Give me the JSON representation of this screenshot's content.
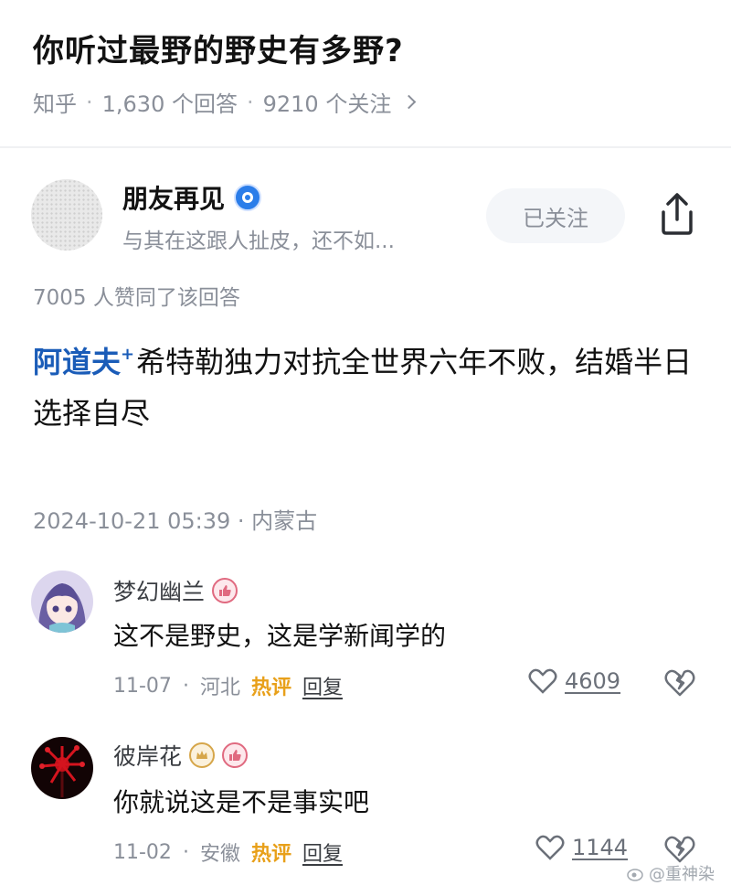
{
  "question": {
    "title": "你听过最野的野史有多野?",
    "source": "知乎",
    "answers": "1,630 个回答",
    "followers": "9210 个关注"
  },
  "author": {
    "name": "朋友再见",
    "bio": "与其在这跟人扯皮，还不如...",
    "follow_label": "已关注"
  },
  "answer": {
    "likes_text": "7005 人赞同了该回答",
    "link_text": "阿道夫",
    "body_text": "希特勒独力对抗全世界六年不败，结婚半日选择自尽",
    "date": "2024-10-21 05:39 · 内蒙古"
  },
  "comments": [
    {
      "name": "梦幻幽兰",
      "text": "这不是野史，这是学新闻学的",
      "date": "11-07",
      "location": "河北",
      "hot_label": "热评",
      "reply_label": "回复",
      "likes": "4609"
    },
    {
      "name": "彼岸花",
      "text": "你就说这是不是事实吧",
      "date": "11-02",
      "location": "安徽",
      "hot_label": "热评",
      "reply_label": "回复",
      "likes": "1144"
    }
  ],
  "watermark": "@重神染",
  "icons": {
    "chevron": "chevron-right-icon",
    "share": "share-icon",
    "like": "heart-icon",
    "dislike": "broken-heart-icon"
  },
  "colors": {
    "link": "#1a5cb8",
    "hot": "#e8a01a",
    "muted": "#8a8f99"
  }
}
